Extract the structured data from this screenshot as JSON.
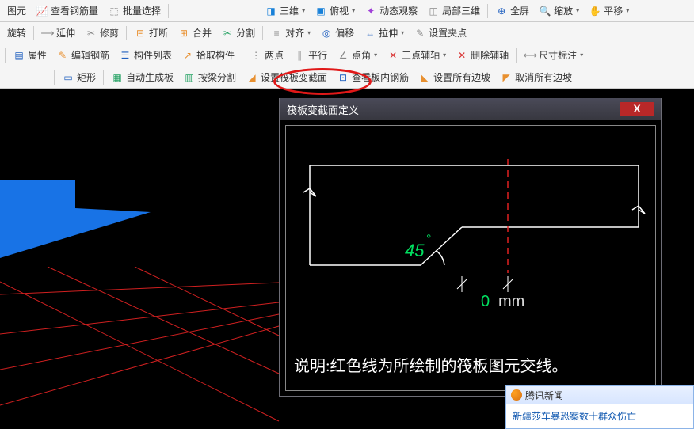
{
  "toolbar1": {
    "item_element": "图元",
    "view_steel": "查看钢筋量",
    "batch_select": "批量选择",
    "three_d": "三维",
    "top_view": "俯视",
    "dyn_view": "动态观察",
    "partial_3d": "局部三维",
    "full_screen": "全屏",
    "zoom": "缩放",
    "pan": "平移"
  },
  "toolbar2": {
    "rotate": "旋转",
    "extend": "延伸",
    "trim": "修剪",
    "break": "打断",
    "merge": "合并",
    "split": "分割",
    "align": "对齐",
    "offset": "偏移",
    "stretch": "拉伸",
    "set_grip": "设置夹点"
  },
  "toolbar3": {
    "properties": "属性",
    "edit_rebar": "编辑钢筋",
    "component_list": "构件列表",
    "pick_component": "拾取构件",
    "two_pt": "两点",
    "parallel": "平行",
    "angle_pt": "点角",
    "three_axis": "三点辅轴",
    "del_axis": "删除辅轴",
    "dim_annotate": "尺寸标注"
  },
  "toolbar4": {
    "rect": "矩形",
    "auto_gen": "自动生成板",
    "by_beam": "按梁分割",
    "set_section": "设置筏板变截面",
    "view_inner_rebar": "查看板内钢筋",
    "set_all_slope": "设置所有边坡",
    "cancel_all_slope": "取消所有边坡"
  },
  "dialog": {
    "title": "筏板变截面定义",
    "angle_label": "45",
    "angle_deg": "°",
    "dim_value": "0",
    "dim_unit": "mm",
    "explain": "说明:红色线为所绘制的筏板图元交线。"
  },
  "news": {
    "source": "腾讯新闻",
    "headline": "新疆莎车暴恐案数十群众伤亡"
  }
}
